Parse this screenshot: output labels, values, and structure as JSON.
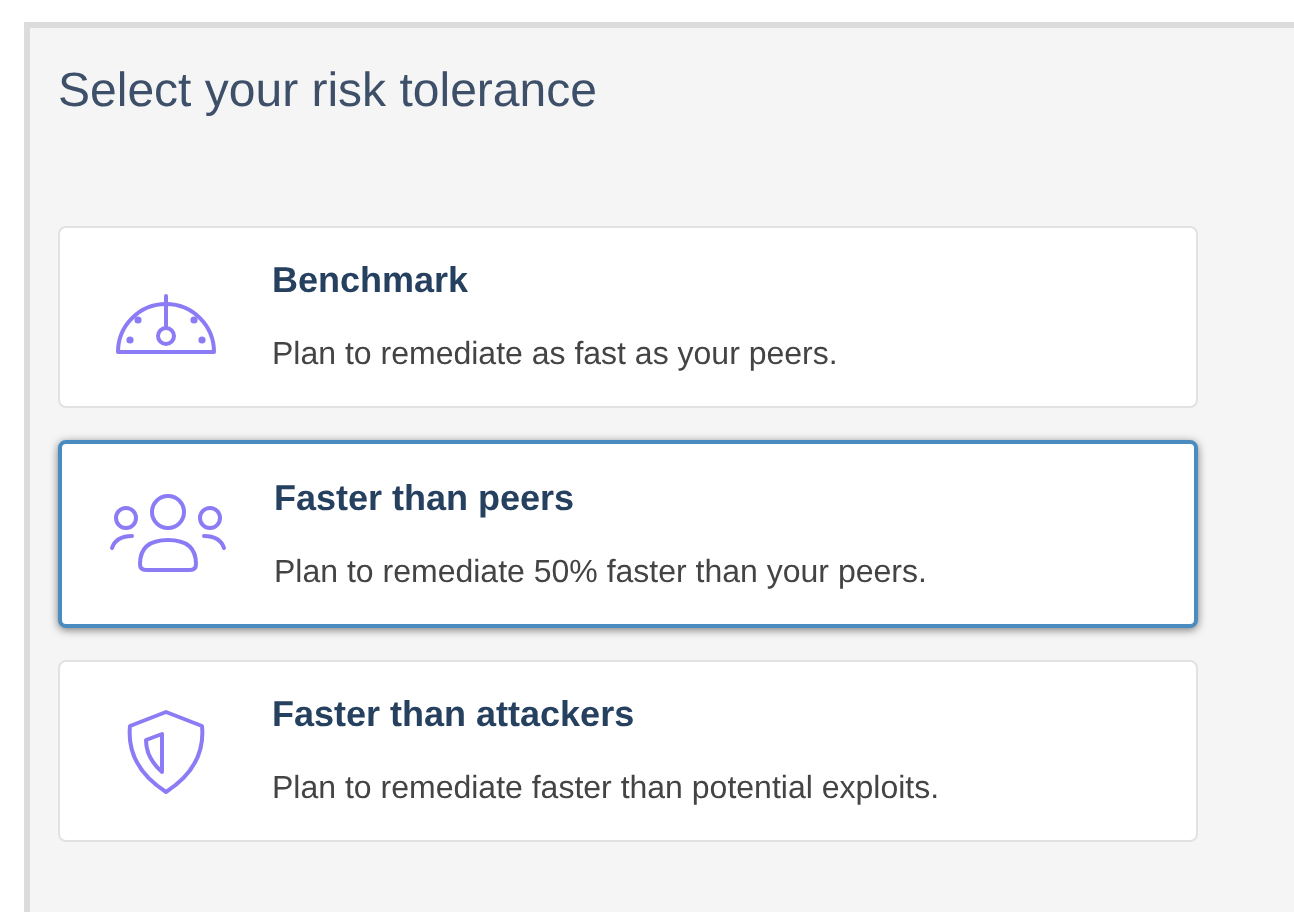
{
  "title": "Select your risk tolerance",
  "options": [
    {
      "title": "Benchmark",
      "description": "Plan to remediate as fast as your peers.",
      "selected": false
    },
    {
      "title": "Faster than peers",
      "description": "Plan to remediate 50% faster than your peers.",
      "selected": true
    },
    {
      "title": "Faster than attackers",
      "description": "Plan to remediate faster than potential exploits.",
      "selected": false
    }
  ]
}
